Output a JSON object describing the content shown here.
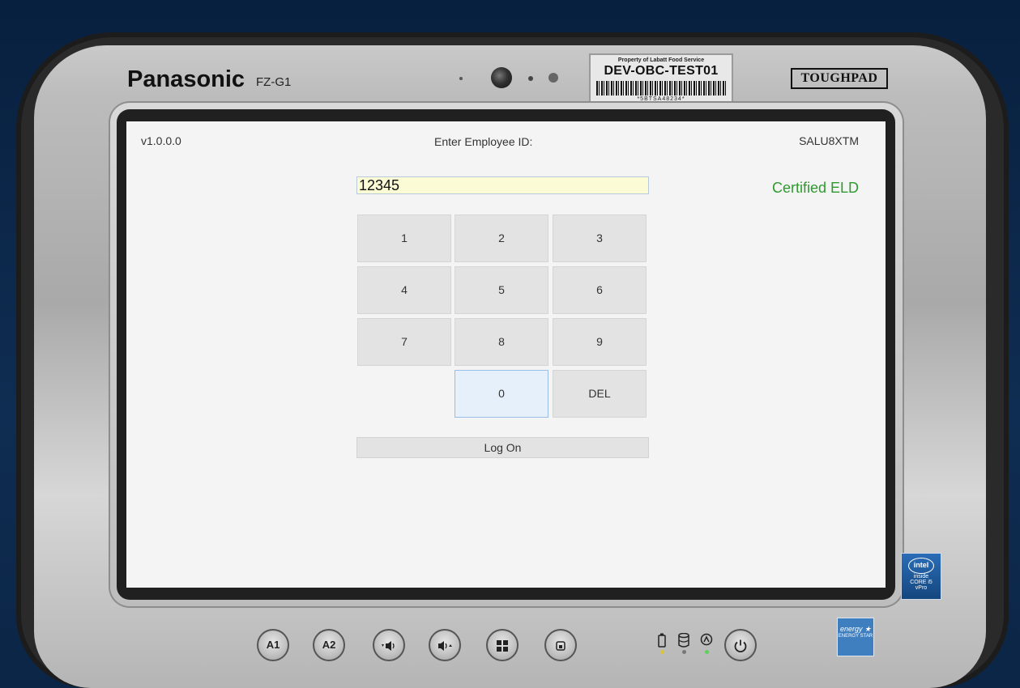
{
  "device": {
    "brand": "Panasonic",
    "model": "FZ-G1",
    "series_badge": "TOUGHPAD",
    "asset_tag": {
      "owner": "Property of Labatt Food Service",
      "name": "DEV-OBC-TEST01",
      "serial": "*5BTSA48234*"
    },
    "intel_badge": {
      "logo": "intel",
      "line1": "inside",
      "line2": "CORE i5",
      "line3": "vPro"
    },
    "energy_badge": {
      "label": "ENERGY STAR"
    },
    "hardware_buttons": [
      {
        "label": "A1",
        "icon": ""
      },
      {
        "label": "A2",
        "icon": ""
      },
      {
        "label": "",
        "icon": "volume-down-icon"
      },
      {
        "label": "",
        "icon": "volume-up-icon"
      },
      {
        "label": "",
        "icon": "windows-icon"
      },
      {
        "label": "",
        "icon": "rotation-lock-icon"
      },
      {
        "label": "",
        "icon": "power-icon"
      }
    ],
    "status_indicators": [
      "battery-icon",
      "storage-icon",
      "wireless-icon"
    ]
  },
  "screen": {
    "version": "v1.0.0.0",
    "title": "Enter Employee ID:",
    "device_id": "SALU8XTM",
    "certified": "Certified ELD",
    "input_value": "12345",
    "keypad": {
      "k1": "1",
      "k2": "2",
      "k3": "3",
      "k4": "4",
      "k5": "5",
      "k6": "6",
      "k7": "7",
      "k8": "8",
      "k9": "9",
      "k0": "0",
      "del": "DEL"
    },
    "logon_label": "Log On",
    "colors": {
      "certified": "#2e9a2e",
      "input_bg": "#fbfbd6",
      "focused_key": "#e6f0fb"
    }
  }
}
